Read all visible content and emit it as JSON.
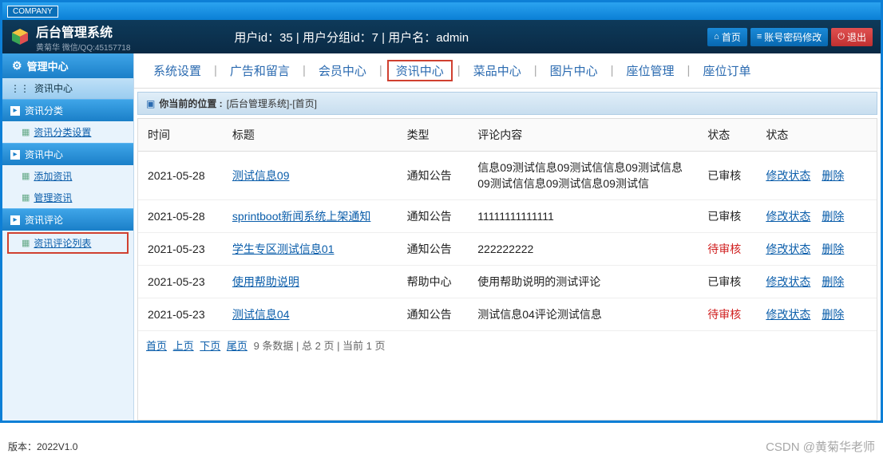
{
  "titlebar": "COMPANY",
  "brand": {
    "title": "后台管理系统",
    "sub": "黄菊华 微信/QQ:45157718"
  },
  "userinfo": "用户id：35 | 用户分组id：7 | 用户名：admin",
  "header_buttons": {
    "home": "首页",
    "pwd": "账号密码修改",
    "exit": "退出"
  },
  "sidebar": {
    "center": "管理中心",
    "info_center": "资讯中心",
    "groups": [
      {
        "title": "资讯分类",
        "items": [
          {
            "label": "资讯分类设置",
            "boxed": false
          }
        ]
      },
      {
        "title": "资讯中心",
        "items": [
          {
            "label": "添加资讯",
            "boxed": false
          },
          {
            "label": "管理资讯",
            "boxed": false
          }
        ]
      },
      {
        "title": "资讯评论",
        "items": [
          {
            "label": "资讯评论列表",
            "boxed": true
          }
        ]
      }
    ]
  },
  "topnav": {
    "items": [
      "系统设置",
      "广告和留言",
      "会员中心",
      "资讯中心",
      "菜品中心",
      "图片中心",
      "座位管理",
      "座位订单"
    ],
    "active_index": 3
  },
  "breadcrumb": {
    "prefix": "你当前的位置 :",
    "path": "[后台管理系统]-[首页]"
  },
  "table": {
    "headers": [
      "时间",
      "标题",
      "类型",
      "评论内容",
      "状态",
      "状态"
    ],
    "rows": [
      {
        "time": "2021-05-28",
        "title": "测试信息09",
        "type": "通知公告",
        "content": "信息09测试信息09测试信信息09测试信息09测试信信息09测试信息09测试信",
        "status": "已审核",
        "status_class": "ok"
      },
      {
        "time": "2021-05-28",
        "title": "sprintboot新闻系统上架通知",
        "type": "通知公告",
        "content": "11111111111111",
        "status": "已审核",
        "status_class": "ok"
      },
      {
        "time": "2021-05-23",
        "title": "学生专区测试信息01",
        "type": "通知公告",
        "content": "222222222",
        "status": "待审核",
        "status_class": "pending"
      },
      {
        "time": "2021-05-23",
        "title": "使用帮助说明",
        "type": "帮助中心",
        "content": "使用帮助说明的测试评论",
        "status": "已审核",
        "status_class": "ok"
      },
      {
        "time": "2021-05-23",
        "title": "测试信息04",
        "type": "通知公告",
        "content": "测试信息04评论测试信息",
        "status": "待审核",
        "status_class": "pending"
      }
    ],
    "actions": {
      "edit": "修改状态",
      "del": "删除"
    }
  },
  "pager": {
    "first": "首页",
    "prev": "上页",
    "next": "下页",
    "last": "尾页",
    "info": "9 条数据 | 总 2 页 | 当前 1 页"
  },
  "footer": "版本：2022V1.0",
  "watermark": "CSDN @黄菊华老师"
}
